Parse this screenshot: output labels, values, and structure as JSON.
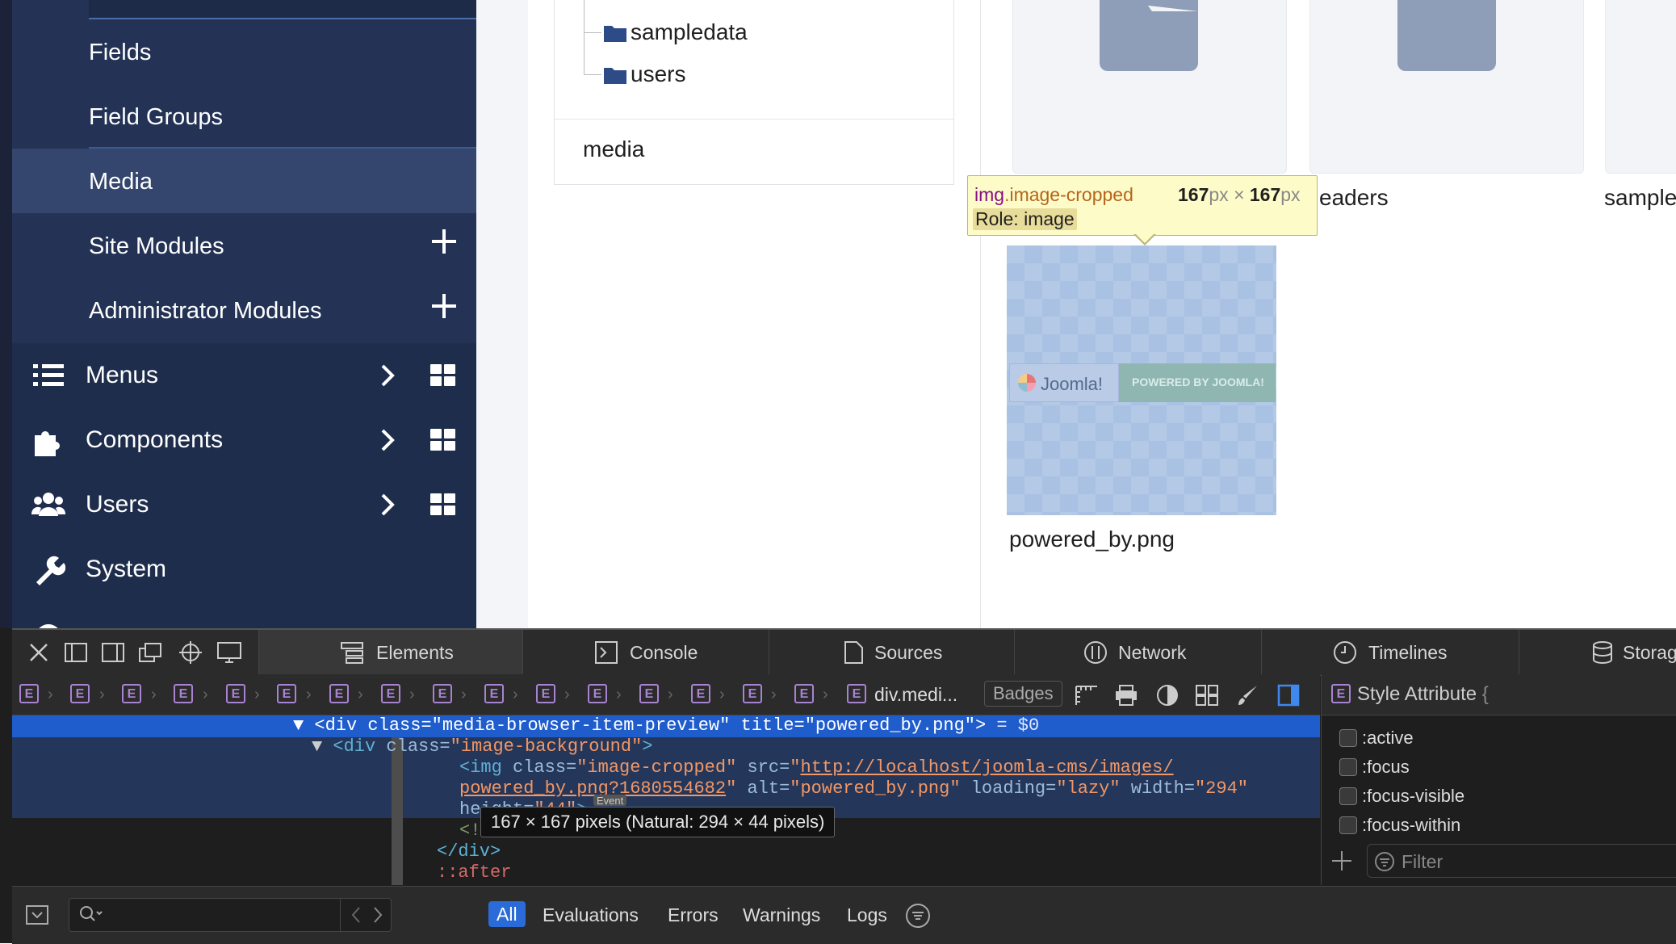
{
  "sidebar": {
    "sub_items": [
      {
        "label": "Fields"
      },
      {
        "label": "Field Groups"
      },
      {
        "label": "Media"
      },
      {
        "label": "Site Modules"
      },
      {
        "label": "Administrator Modules"
      }
    ],
    "main_items": [
      {
        "label": "Menus",
        "icon": "list-icon"
      },
      {
        "label": "Components",
        "icon": "puzzle-icon"
      },
      {
        "label": "Users",
        "icon": "users-icon"
      },
      {
        "label": "System",
        "icon": "wrench-icon"
      }
    ]
  },
  "tree": {
    "folders": [
      "sampledata",
      "users"
    ],
    "root": "media"
  },
  "tiles": {
    "partial_labels": [
      "eaders",
      "sample"
    ],
    "file_label": "powered_by.png",
    "banner_logo_text": "Joomla!",
    "banner_text": "POWERED BY JOOMLA!"
  },
  "inspector_tooltip": {
    "tag": "img",
    "class": ".image-cropped",
    "width": "167",
    "height": "167",
    "unit": "px",
    "times": "×",
    "role_label": "Role: image"
  },
  "devtools": {
    "tabs": [
      "Elements",
      "Console",
      "Sources",
      "Network",
      "Timelines",
      "Storage"
    ],
    "breadcrumb_letter": "E",
    "breadcrumb_last": "div.medi...",
    "badges_label": "Badges",
    "dom": {
      "line1_tag_open": "<div ",
      "line1_attr1": "class=",
      "line1_val1": "\"media-browser-item-preview\"",
      "line1_attr2": " title=",
      "line1_val2": "\"powered_by.png\"",
      "line1_tag_close": ">",
      "line1_ref": " = $0",
      "line2_tag_open": "<div ",
      "line2_attr": "class=",
      "line2_val": "\"image-background\"",
      "line2_tag_close": ">",
      "line3_tag_open": "<img ",
      "line3_attr1": "class=",
      "line3_val1": "\"image-cropped\"",
      "line3_attr2": " src=",
      "line3_link1": "http://localhost/joomla-cms/images/",
      "line4_link2": "powered_by.png?1680554682",
      "line4_quote": "\"",
      "line4_attr1": " alt=",
      "line4_val1": "\"powered_by.png\"",
      "line4_attr2": " loading=",
      "line4_val2": "\"lazy\"",
      "line4_attr3": " width=",
      "line4_val3": "\"294\"",
      "line5_attr": "height=",
      "line5_val": "\"44\"",
      "line5_close": ">",
      "event_badge": "Event",
      "line6": "<!",
      "line7": "</div>",
      "line8": "::after"
    },
    "dimension_tooltip": "167 × 167 pixels (Natural: 294 × 44 pixels)",
    "styles": {
      "header": "Style Attribute",
      "brace": "{",
      "pseudo_classes": [
        ":active",
        ":focus",
        ":focus-visible",
        ":focus-within"
      ],
      "filter_placeholder": "Filter"
    },
    "console_filters": [
      "All",
      "Evaluations",
      "Errors",
      "Warnings",
      "Logs"
    ]
  }
}
